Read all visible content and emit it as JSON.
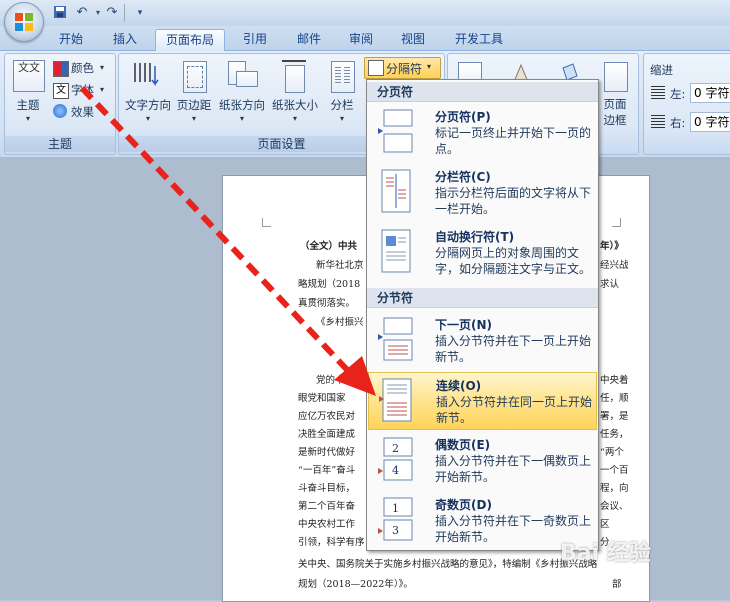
{
  "quick_access": {
    "save_icon": "save-icon",
    "undo_icon": "undo-icon",
    "redo_icon": "redo-icon"
  },
  "tabs": [
    "开始",
    "插入",
    "页面布局",
    "引用",
    "邮件",
    "审阅",
    "视图",
    "开发工具"
  ],
  "active_tab": "页面布局",
  "theme_group": {
    "label": "主题",
    "main_button": "主题",
    "colors": "颜色",
    "fonts": "字体",
    "effects": "效果",
    "main_icon_text": "文文"
  },
  "page_setup_group": {
    "label": "页面设置",
    "buttons": [
      "文字方向",
      "页边距",
      "纸张方向",
      "纸张大小",
      "分栏"
    ],
    "breaks_button": "分隔符"
  },
  "page_bg_group": {
    "page_border": "页面\n边框"
  },
  "indent_group": {
    "label": "缩进",
    "left_label": "左:",
    "left_value": "0 字符",
    "right_label": "右:",
    "right_value": "0 字符"
  },
  "breaks_menu": {
    "page_section_header": "分页符",
    "section_breaks_header": "分节符",
    "items": [
      {
        "title": "分页符(P)",
        "desc": "标记一页终止并开始下一页的点。"
      },
      {
        "title": "分栏符(C)",
        "desc": "指示分栏符后面的文字将从下一栏开始。"
      },
      {
        "title": "自动换行符(T)",
        "desc": "分隔网页上的对象周围的文字，如分隔题注文字与正文。"
      },
      {
        "title": "下一页(N)",
        "desc": "插入分节符并在下一页上开始新节。"
      },
      {
        "title": "连续(O)",
        "desc": "插入分节符并在同一页上开始新节。"
      },
      {
        "title": "偶数页(E)",
        "desc": "插入分节符并在下一偶数页上开始新节。"
      },
      {
        "title": "奇数页(D)",
        "desc": "插入分节符并在下一奇数页上开始新节。"
      }
    ],
    "highlighted": "连续(O)",
    "even_icon_number": "2",
    "even_icon_number2": "4",
    "odd_icon_number": "1",
    "odd_icon_number2": "3"
  },
  "document": {
    "lines": [
      "（全文）中共",
      "新华社北京",
      "略规划（2018",
      "真贯彻落实。",
      "《乡村振兴",
      "",
      "党的十九",
      "眼党和国家",
      "应亿万农民对",
      "决胜全面建成",
      "是新时代做好",
      "“一百年”奋斗",
      "斗奋斗目标，",
      "第二个百年奋",
      "中央农村工作",
      "引领，科学有序",
      "关中央、国务院关于实施乡村振兴战略的意见》，特编制《乡村振兴战略",
      "规划（2018—2022年）》。"
    ],
    "right_fragments": [
      "年）》",
      "经兴战",
      "求认",
      "中央着",
      "任，顺",
      "署，是",
      "任务，",
      "“两个",
      "一个百",
      "程，向",
      "会议、",
      "区",
      "分",
      "部"
    ]
  },
  "watermark": "Bai 经验",
  "colors": {
    "arrow": "#e8231b",
    "highlight": "#ffd45a",
    "ribbon": "#d3e1f3"
  }
}
